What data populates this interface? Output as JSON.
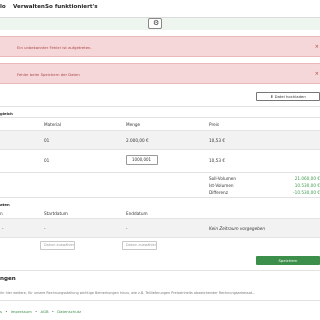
{
  "nav": {
    "items": [
      {
        "label": "lo"
      },
      {
        "label": "Verwalten"
      },
      {
        "label": "So funktioniert's"
      }
    ]
  },
  "alerts": [
    {
      "text": "Ein unbekannter Fehler ist aufgetreten.",
      "close": "×"
    },
    {
      "text": "Fehler beim Speichern der Daten",
      "close": "×"
    }
  ],
  "upload": {
    "label": "Datei hochladen"
  },
  "section_title": "gleich",
  "table": {
    "headers": [
      "Material",
      "Menge",
      "Preis"
    ],
    "rows": [
      {
        "material": "01",
        "menge": "2.000,00 €",
        "preis": "10,53 €"
      },
      {
        "material": "01",
        "menge": "1000,001",
        "preis": "10,53 €"
      }
    ]
  },
  "summary": {
    "rows": [
      {
        "label": "Soll-Volumen",
        "value": "21.060,00 €"
      },
      {
        "label": "Ist-Volumen",
        "value": "10.530,00 €"
      },
      {
        "label": "Differenz",
        "value": "-10.530,00 €"
      }
    ],
    "accent": "#3c9a4a"
  },
  "periods": {
    "title": "aten",
    "headers": [
      "n",
      "Startdatum",
      "Enddatum"
    ],
    "row": {
      "col1": "-",
      "start": "-",
      "end": "-",
      "note": "Kein Zeitraum vorgegeben"
    },
    "start_placeholder": "Datum auswählen",
    "end_placeholder": "Datum auswählen"
  },
  "save": {
    "label": "Speichern"
  },
  "notes": {
    "title": "ngen",
    "text": "ihr hier weitere, für unsere Rechnungsstellung wichtige Bemerkungen hinzu, wie z.B. Teillieferungen Preiseinheits abweichender Rechnungsadressat..."
  },
  "footer": {
    "links": [
      "Impressum",
      "AGB",
      "Datenschutz"
    ],
    "prefix": "s",
    "sep": "•"
  },
  "colors": {
    "alert_bg": "#f6d7d9",
    "alert_text": "#a94442",
    "primary": "#3b8f4a"
  },
  "icons": {
    "settings": "gear-icon"
  }
}
